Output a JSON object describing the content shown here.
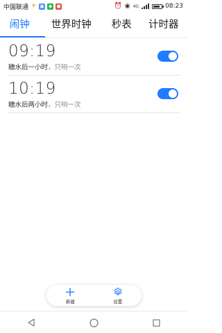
{
  "status_bar": {
    "carrier": "中国联通",
    "time": "08:23",
    "icons": [
      "sun-icon",
      "notification-icon",
      "app-icon",
      "app-icon-red",
      "alarm-clock-icon",
      "eye-icon",
      "wifi-icon",
      "signal-icon",
      "battery-icon"
    ],
    "battery_level": 0.8,
    "wifi_text": "4G"
  },
  "tabs": [
    {
      "label": "闹钟",
      "active": true
    },
    {
      "label": "世界时钟",
      "active": false
    },
    {
      "label": "秒表",
      "active": false
    },
    {
      "label": "计时器",
      "active": false
    }
  ],
  "alarms": [
    {
      "time": "09:19",
      "label": "糖水后一小时",
      "sub": "，只响一次",
      "enabled": true
    },
    {
      "time": "10:19",
      "label": "糖水后两小时",
      "sub": "，只响一次",
      "enabled": true
    }
  ],
  "action_bar": {
    "new_label": "新建",
    "settings_label": "设置"
  },
  "colors": {
    "accent": "#1f7cff",
    "text": "#333333",
    "subtext": "#888888"
  },
  "nav": {
    "back": "back-icon",
    "home": "home-icon",
    "recent": "recent-apps-icon"
  }
}
